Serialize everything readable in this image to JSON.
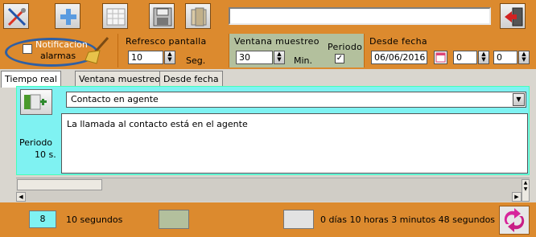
{
  "toolbar": {
    "icons": [
      "tools-icon",
      "add-icon",
      "calendar-grid-icon",
      "save-icon",
      "folder-icon",
      "exit-door-icon"
    ],
    "title_value": ""
  },
  "notification": {
    "label_line1": "Notificacion",
    "label_line2": "alarmas",
    "checked": false,
    "highlight_color": "#2f5fa3"
  },
  "refresh": {
    "label": "Refresco pantalla",
    "value": "10",
    "unit": "Seg."
  },
  "window": {
    "label": "Ventana muestreo",
    "value": "30",
    "unit": "Min.",
    "periodo_label": "Periodo",
    "periodo_checked": true
  },
  "from_date": {
    "label": "Desde fecha",
    "date": "06/06/2016",
    "hour": "0",
    "minute": "0"
  },
  "tabs": [
    {
      "label": "Tiempo real",
      "active": true
    },
    {
      "label": "Ventana muestreo",
      "active": false
    },
    {
      "label": "Desde fecha",
      "active": false
    }
  ],
  "panel": {
    "periodo_label": "Periodo",
    "periodo_value": "10 s.",
    "select_value": "Contacto en agente",
    "description": "La llamada al contacto está en el agente",
    "background": "#7ff2f2"
  },
  "status": {
    "count": "8",
    "seconds_text": "10 segundos",
    "swatch1_color": "#b3c09d",
    "swatch2_color": "#e2e2e2",
    "elapsed_text": "0 días 10 horas 3 minutos 48 segundos",
    "accent": "#dc8a2e"
  }
}
